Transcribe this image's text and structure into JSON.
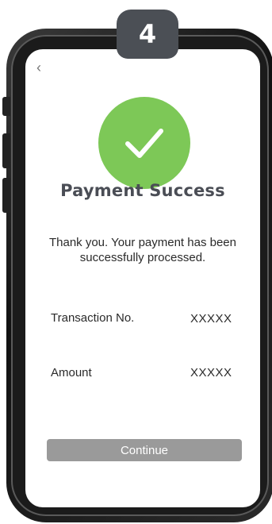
{
  "step": {
    "number": "4"
  },
  "screen": {
    "back_icon": "chevron-left-icon",
    "title": "Payment Success",
    "message": "Thank you. Your payment has been successfully processed.",
    "transaction": {
      "label": "Transaction No.",
      "value": "XXXXX"
    },
    "amount": {
      "label": "Amount",
      "value": "XXXXX"
    },
    "continue_label": "Continue"
  },
  "colors": {
    "success_green": "#7dc857",
    "title_color": "#4a4d55",
    "button_gray": "#9a9a9a",
    "badge_gray": "#4b4f55"
  }
}
